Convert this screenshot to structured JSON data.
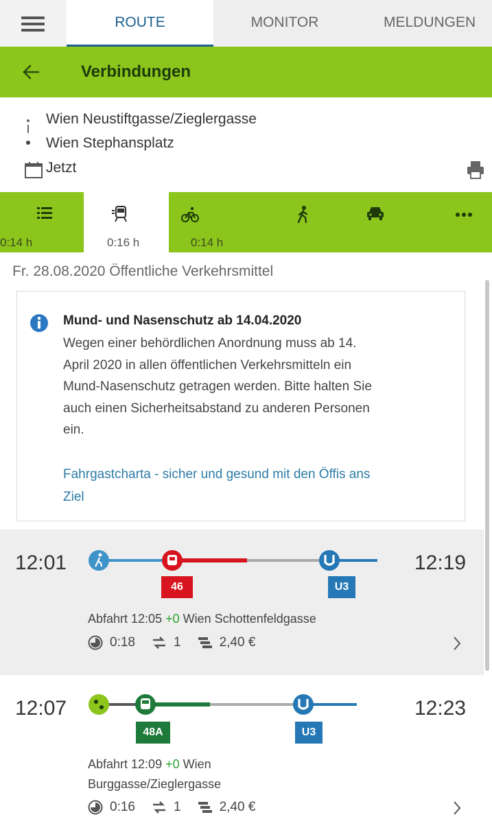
{
  "tabs": [
    {
      "label": "ROUTE",
      "active": true
    },
    {
      "label": "MONITOR",
      "active": false
    },
    {
      "label": "MELDUNGEN",
      "active": false
    }
  ],
  "header": {
    "title": "Verbindungen"
  },
  "route": {
    "from": "Wien Neustiftgasse/Zieglergasse",
    "to": "Wien Stephansplatz",
    "when": "Jetzt"
  },
  "modes": [
    {
      "icon": "list-icon",
      "duration": "0:14 h"
    },
    {
      "icon": "public-transport-icon",
      "duration": "0:16 h",
      "active": true
    },
    {
      "icon": "bicycle-icon",
      "duration": "0:14 h"
    },
    {
      "icon": "walk-icon",
      "duration": ""
    },
    {
      "icon": "car-icon",
      "duration": ""
    },
    {
      "icon": "more-icon",
      "duration": ""
    }
  ],
  "date_line": "Fr. 28.08.2020 Öffentliche Verkehrsmittel",
  "notice": {
    "title": "Mund- und Nasenschutz ab 14.04.2020",
    "lines": [
      "Wegen einer behördlichen Anordnung muss ab 14.",
      "April 2020 in allen öffentlichen Verkehrsmitteln ein",
      "Mund-Nasenschutz getragen werden. Bitte halten Sie",
      "auch einen Sicherheitsabstand zu anderen Personen",
      "ein."
    ],
    "link_lines": [
      "Fahrgastcharta - sicher und gesund mit den Öffis ans",
      "Ziel"
    ]
  },
  "connections": [
    {
      "depart": "12:01",
      "arrive": "12:19",
      "lines": [
        {
          "label": "46",
          "color": "#d7141f"
        },
        {
          "label": "U3",
          "color": "#2578b5"
        }
      ],
      "departure_label": "Abfahrt 12:05",
      "delay": "+0",
      "stop_lines": [
        "Wien Schottenfeldgasse"
      ],
      "duration": "0:18",
      "changes": "1",
      "price": "2,40 €"
    },
    {
      "depart": "12:07",
      "arrive": "12:23",
      "lines": [
        {
          "label": "48A",
          "color": "#1d7a3b"
        },
        {
          "label": "U3",
          "color": "#2578b5"
        }
      ],
      "departure_label": "Abfahrt 12:09",
      "delay": "+0",
      "stop_lines": [
        "Wien",
        "Burggasse/Zieglergasse"
      ],
      "duration": "0:16",
      "changes": "1",
      "price": "2,40 €"
    }
  ],
  "colors": {
    "accent_green": "#8cc51c",
    "tram_red": "#d7141f",
    "bus_green": "#1d7a3b",
    "ubahn_blue": "#2578b5",
    "walk_blue": "#3e93c8"
  }
}
